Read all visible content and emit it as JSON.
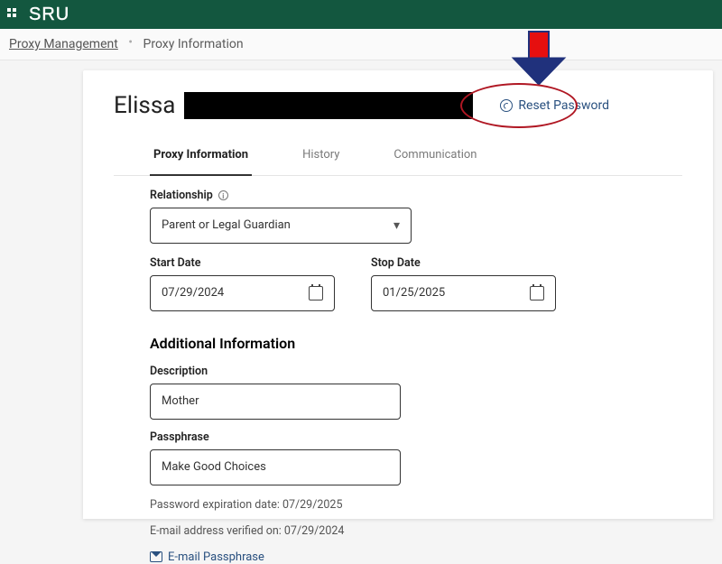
{
  "brand": "SRU",
  "breadcrumb": {
    "root": "Proxy Management",
    "current": "Proxy Information"
  },
  "header": {
    "first_name": "Elissa",
    "reset_label": "Reset Password"
  },
  "tabs": [
    {
      "label": "Proxy Information",
      "active": true
    },
    {
      "label": "History",
      "active": false
    },
    {
      "label": "Communication",
      "active": false
    }
  ],
  "relationship": {
    "label": "Relationship",
    "value": "Parent or Legal Guardian"
  },
  "dates": {
    "start_label": "Start Date",
    "start_value": "07/29/2024",
    "stop_label": "Stop Date",
    "stop_value": "01/25/2025"
  },
  "additional": {
    "heading": "Additional Information",
    "description_label": "Description",
    "description_value": "Mother",
    "passphrase_label": "Passphrase",
    "passphrase_value": "Make Good Choices",
    "pw_expire": "Password expiration date: 07/29/2025",
    "email_verified": "E-mail address verified on: 07/29/2024",
    "email_passphrase": "E-mail Passphrase"
  }
}
